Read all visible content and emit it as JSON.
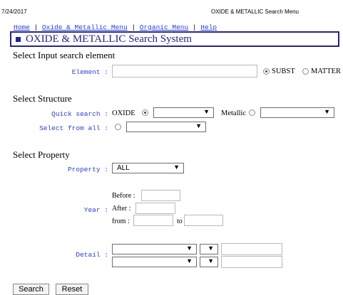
{
  "print_header": {
    "date": "7/24/2017",
    "title": "OXIDE & METALLIC Search Menu"
  },
  "nav": {
    "items": [
      "Home",
      "Oxide & Metallic Menu",
      "Organic Menu",
      "Help"
    ],
    "separator": "|"
  },
  "title": "OXIDE & METALLIC Search System",
  "input_section": {
    "heading": "Select Input search element",
    "element_label": "Element :",
    "element_value": "",
    "radio_subst_label": "SUBST",
    "radio_matter_label": "MATTER",
    "selected": "SUBST"
  },
  "structure_section": {
    "heading": "Select Structure",
    "quick_search_label": "Quick search :",
    "oxide_label": "OXIDE",
    "oxide_selected": true,
    "oxide_select_value": "",
    "metallic_label": "Metallic",
    "metallic_selected": false,
    "metallic_select_value": "",
    "select_from_all_label": "Select from all :",
    "all_selected": false,
    "all_select_value": ""
  },
  "property_section": {
    "heading": "Select Property",
    "property_label": "Property :",
    "property_value": "ALL",
    "year_label": "Year :",
    "before_label": "Before :",
    "after_label": "After :",
    "from_label": "from :",
    "to_label": "to",
    "detail_label": "Detail :"
  },
  "buttons": {
    "search": "Search",
    "reset": "Reset"
  },
  "glyphs": {
    "dropdown_arrow": "▼",
    "colon": ":"
  }
}
